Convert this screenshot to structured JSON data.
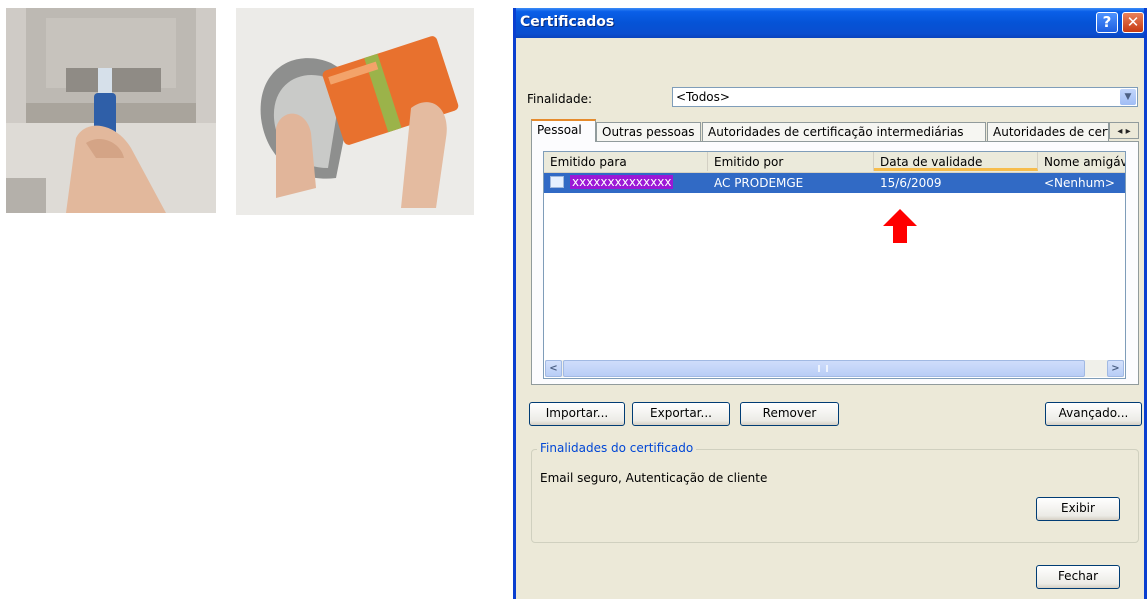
{
  "dialog": {
    "title": "Certificados",
    "help_label": "?",
    "close_label": "✕",
    "finalidade": {
      "label": "Finalidade:",
      "value": "<Todos>"
    },
    "tabs": [
      {
        "label": "Pessoal",
        "active": true
      },
      {
        "label": "Outras pessoas",
        "active": false
      },
      {
        "label": "Autoridades de certificação intermediárias",
        "active": false
      },
      {
        "label": "Autoridades de cert",
        "active": false
      }
    ],
    "tab_scroll_label": "◂ ▸",
    "list": {
      "columns": [
        "Emitido para",
        "Emitido por",
        "Data de validade",
        "Nome amigáv"
      ],
      "rows": [
        {
          "emitido_para": "xxxxxxxxxxxxxx",
          "emitido_por": "AC PRODEMGE",
          "validade": "15/6/2009",
          "nome": "<Nenhum>"
        }
      ]
    },
    "scroll": {
      "left": "<",
      "right": ">"
    },
    "buttons": {
      "importar": "Importar...",
      "exportar": "Exportar...",
      "remover": "Remover",
      "avancado": "Avançado...",
      "exibir": "Exibir",
      "fechar": "Fechar"
    },
    "finalidades_group": {
      "legend": "Finalidades do certificado",
      "text": "Email seguro, Autenticação de cliente"
    }
  },
  "colors": {
    "titlebar": "#0553d6",
    "selection": "#316ac5",
    "arrow": "#ff0000",
    "redacted": "#9b18d6"
  }
}
